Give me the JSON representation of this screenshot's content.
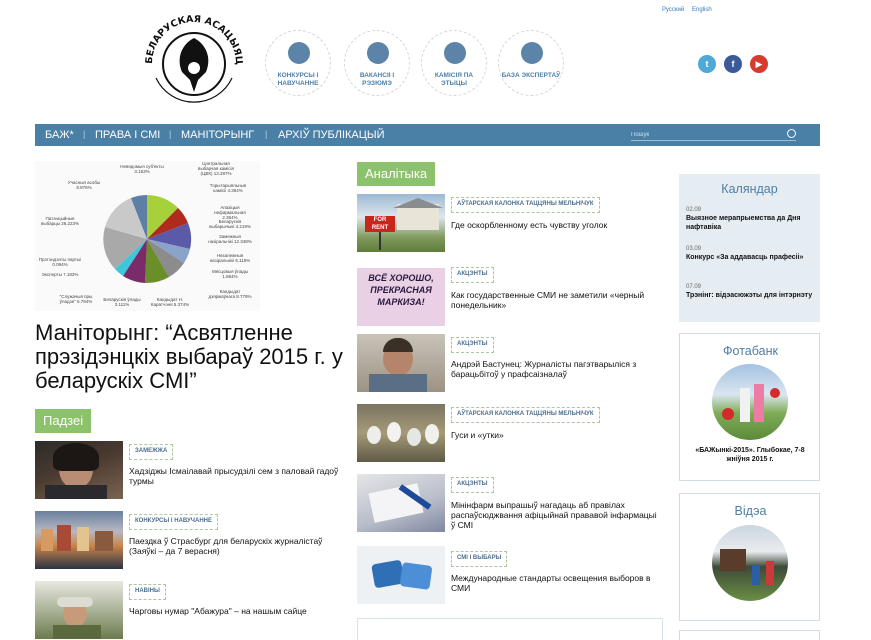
{
  "header": {
    "logo_text": "БЕЛАРУСКАЯ АСАЦЫЯЦЫЯ ЖУРНАЛІСТАЎ",
    "languages": [
      "Русский",
      "English"
    ],
    "quick_links": [
      {
        "label": "КОНКУРСЫ І НАВУЧАННЕ",
        "icon": "disc-icon"
      },
      {
        "label": "ВАКАНСІІ І РЭЗЮМЭ",
        "icon": "pencil-icon"
      },
      {
        "label": "КАМІСІЯ ПА ЭТЫЦЫ",
        "icon": "people-icon"
      },
      {
        "label": "БАЗА ЭКСПЕРТАЎ",
        "icon": "folder-icon"
      }
    ],
    "social": [
      {
        "name": "twitter-icon",
        "glyph": "t",
        "color": "#4ea9d8"
      },
      {
        "name": "facebook-icon",
        "glyph": "f",
        "color": "#3b5a9a"
      },
      {
        "name": "youtube-icon",
        "glyph": "▶",
        "color": "#d63b2f"
      }
    ]
  },
  "nav": {
    "items": [
      "БАЖ*",
      "ПРАВА І СМІ",
      "МАНІТОРЫНГ",
      "АРХІЎ ПУБЛІКАЦЫЙ"
    ],
    "search_placeholder": "Пошук"
  },
  "feature": {
    "headline": "Маніторынг: “Асвятленне прэзідэнцкіх выбараў 2015 г. у беларускіх СМІ”",
    "pie_labels": [
      "Невядомыя суб'екты 3.163%",
      "Цэнтральная выбарчая камісія (ЦВК) 13.287%",
      "Учасныя асобы 8.876%",
      "Тэрытарыяльныя камісіі 4.364%",
      "Апазіцыя нефармальная 2.364%",
      "Беларускія выбаршчыкі 4.219%",
      "Патэнцыйныя выбарцы 26.223%",
      "Замежныя назіральнікі 12.348%",
      "Незалежныя назіральнікі 6.119%",
      "Прэтэндэнты партыі 0.094%",
      "Мясцовыя ўлады 1.864%",
      "Эксперты 7.183%",
      "Кандыдат дзяржаўнага 8.779%",
      "\"Служачыя пры ўладзе\" 5.794%",
      "Беларускія ўлады 3.111%",
      "Кандыдат Н. Каратчэня 5.374%",
      "Прэзідэнцкія выбары 10.135%"
    ]
  },
  "events": {
    "section_title": "Падзеі",
    "items": [
      {
        "tag": "ЗАМЕЖЖА",
        "title": "Хадзіджы Ісмаілавай прысудзілі сем з паловай гадоў турмы"
      },
      {
        "tag": "КОНКУРСЫ І НАВУЧАННЕ",
        "title": "Паездка ў Страсбург для беларускіх журналістаў (Заяўкі – да 7 верасня)"
      },
      {
        "tag": "НАВІНЫ",
        "title": "Чарговы нумар \"Абажура\" – на нашым сайце"
      }
    ]
  },
  "analytics": {
    "section_title": "Аналітыка",
    "items": [
      {
        "tag": "АЎТАРСКАЯ КАЛОНКА ТАЦЦЯНЫ МЕЛЬНІЧУК",
        "title": "Где оскорбленному есть чувству уголок",
        "img_text": "FOR RENT"
      },
      {
        "tag": "АКЦЭНТЫ",
        "title": "Как государственные СМИ не заметили «черный понедельник»",
        "img_text": "ВСЁ ХОРОШО, ПРЕКРАСНАЯ МАРКИЗА!"
      },
      {
        "tag": "АКЦЭНТЫ",
        "title": "Андрэй Бастунец: Журналісты пагэтварыліся з барацьбітоў у прафсаізналаў",
        "img_text": ""
      },
      {
        "tag": "АЎТАРСКАЯ КАЛОНКА ТАЦЦЯНЫ МЕЛЬНІЧУК",
        "title": "Гуси и «утки»",
        "img_text": ""
      },
      {
        "tag": "АКЦЭНТЫ",
        "title": "Мінінфарм выпрашыў нагадаць аб правілах распаўсюджвання афіцыйнай прававой інфармацыі ў СМІ",
        "img_text": ""
      },
      {
        "tag": "СМІ І ВЫБАРЫ",
        "title": "Международные стандарты освещения выборов в СМИ",
        "img_text": ""
      }
    ]
  },
  "calendar": {
    "title": "Каляндар",
    "items": [
      {
        "date": "02.09",
        "text": "Выязное мерапрыемства да Дня нафтавіка"
      },
      {
        "date": "03.09",
        "text": "Конкурс «За аддавасць прафесіі»"
      },
      {
        "date": "07.09",
        "text": "Трэнінг: відэасюжэты для інтэрнэту"
      }
    ]
  },
  "photobank": {
    "title": "Фотабанк",
    "caption": "«БАЖынкі-2015». Глыбокае, 7-8 жніўня 2015 г."
  },
  "video": {
    "title": "Відэа"
  },
  "colors": {
    "nav": "#4a7fa6",
    "accent_green": "#8dc26c",
    "link_blue": "#4f7ea4"
  }
}
